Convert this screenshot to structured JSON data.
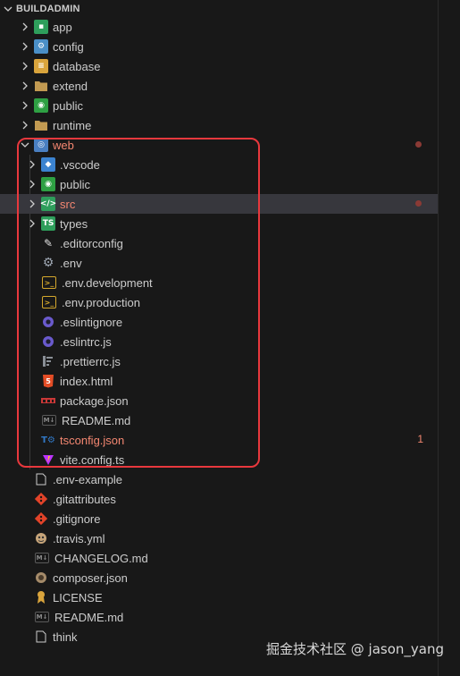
{
  "explorer": {
    "section_title": "BUILDADMIN",
    "watermark": "掘金技术社区 @ jason_yang",
    "items": [
      {
        "label": "app",
        "kind": "folder",
        "icon": "app-folder-icon",
        "color": "#2e9e5b"
      },
      {
        "label": "config",
        "kind": "folder",
        "icon": "config-folder-icon",
        "color": "#4a8fc7"
      },
      {
        "label": "database",
        "kind": "folder",
        "icon": "database-folder-icon",
        "color": "#d9a43c"
      },
      {
        "label": "extend",
        "kind": "folder",
        "icon": "folder-icon",
        "color": "#c29a52"
      },
      {
        "label": "public",
        "kind": "folder",
        "icon": "public-folder-icon",
        "color": "#2ea043"
      },
      {
        "label": "runtime",
        "kind": "folder",
        "icon": "folder-icon",
        "color": "#c29a52"
      },
      {
        "label": "web",
        "kind": "folder-open",
        "icon": "web-folder-icon",
        "color": "#4a7fc1"
      },
      {
        "label": ".vscode",
        "kind": "folder",
        "icon": "vscode-folder-icon",
        "color": "#3b83d0"
      },
      {
        "label": "public",
        "kind": "folder",
        "icon": "public-folder-icon",
        "color": "#2ea043"
      },
      {
        "label": "src",
        "kind": "folder",
        "icon": "src-folder-icon",
        "color": "#2e9e5b"
      },
      {
        "label": "types",
        "kind": "folder",
        "icon": "types-folder-icon",
        "color": "#2e9e5b"
      },
      {
        "label": ".editorconfig",
        "kind": "file",
        "icon": "editorconfig-icon",
        "color": "#e0e0e0"
      },
      {
        "label": ".env",
        "kind": "file",
        "icon": "gear-icon",
        "color": "#9ea7b3"
      },
      {
        "label": ".env.development",
        "kind": "file",
        "icon": "terminal-icon",
        "color": "#d4a72c"
      },
      {
        "label": ".env.production",
        "kind": "file",
        "icon": "terminal-icon",
        "color": "#d4a72c"
      },
      {
        "label": ".eslintignore",
        "kind": "file",
        "icon": "eslint-icon",
        "color": "#6a5acd"
      },
      {
        "label": ".eslintrc.js",
        "kind": "file",
        "icon": "eslint-icon",
        "color": "#6a5acd"
      },
      {
        "label": ".prettierrc.js",
        "kind": "file",
        "icon": "prettier-icon",
        "color": "#8a8f96"
      },
      {
        "label": "index.html",
        "kind": "file",
        "icon": "html5-icon",
        "color": "#e44d26"
      },
      {
        "label": "package.json",
        "kind": "file",
        "icon": "npm-icon",
        "color": "#cb3837"
      },
      {
        "label": "README.md",
        "kind": "file",
        "icon": "markdown-icon",
        "color": "#5a5a5a"
      },
      {
        "label": "tsconfig.json",
        "kind": "file",
        "icon": "tsconfig-icon",
        "color": "#3178c6"
      },
      {
        "label": "vite.config.ts",
        "kind": "file",
        "icon": "vite-icon",
        "color": "#bd34fe"
      },
      {
        "label": ".env-example",
        "kind": "file",
        "icon": "file-icon",
        "color": "#cccccc"
      },
      {
        "label": ".gitattributes",
        "kind": "file",
        "icon": "git-icon",
        "color": "#e24329"
      },
      {
        "label": ".gitignore",
        "kind": "file",
        "icon": "git-icon",
        "color": "#e24329"
      },
      {
        "label": ".travis.yml",
        "kind": "file",
        "icon": "travis-icon",
        "color": "#c7a57a"
      },
      {
        "label": "CHANGELOG.md",
        "kind": "file",
        "icon": "markdown-icon",
        "color": "#5a5a5a"
      },
      {
        "label": "composer.json",
        "kind": "file",
        "icon": "composer-icon",
        "color": "#a58b6a"
      },
      {
        "label": "LICENSE",
        "kind": "file",
        "icon": "license-icon",
        "color": "#d9a43c"
      },
      {
        "label": "README.md",
        "kind": "file",
        "icon": "markdown-icon",
        "color": "#5a5a5a"
      },
      {
        "label": "think",
        "kind": "file",
        "icon": "file-icon",
        "color": "#cccccc"
      }
    ],
    "status": {
      "web_modified_dot": "#8a3a35",
      "src_modified_dot": "#8a3a35",
      "tsconfig_problem_count": "1",
      "error_color": "#f48771",
      "highlight_color": "#e8383d"
    }
  }
}
